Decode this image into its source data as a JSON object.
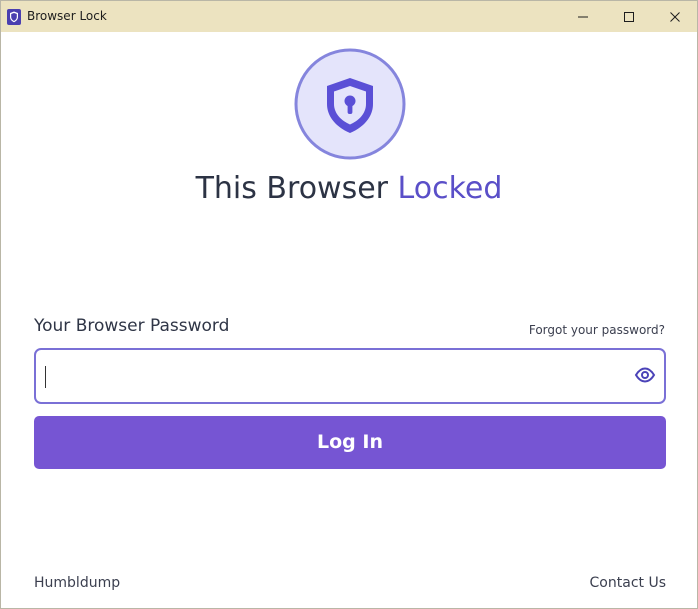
{
  "window": {
    "title": "Browser Lock",
    "titlebar_color": "#ece3c0"
  },
  "header": {
    "logo_icon": "shield-keyhole-icon",
    "headline_main": "This Browser ",
    "headline_accent": "Locked",
    "accent_color": "#5a4fc8"
  },
  "form": {
    "password_label": "Your Browser Password",
    "forgot_link": "Forgot your password?",
    "password_value": "",
    "password_placeholder": "",
    "show_password_icon": "eye-icon",
    "login_label": "Log In",
    "button_color": "#7655d3"
  },
  "footer": {
    "left_link": "Humbldump",
    "right_link": "Contact Us"
  }
}
